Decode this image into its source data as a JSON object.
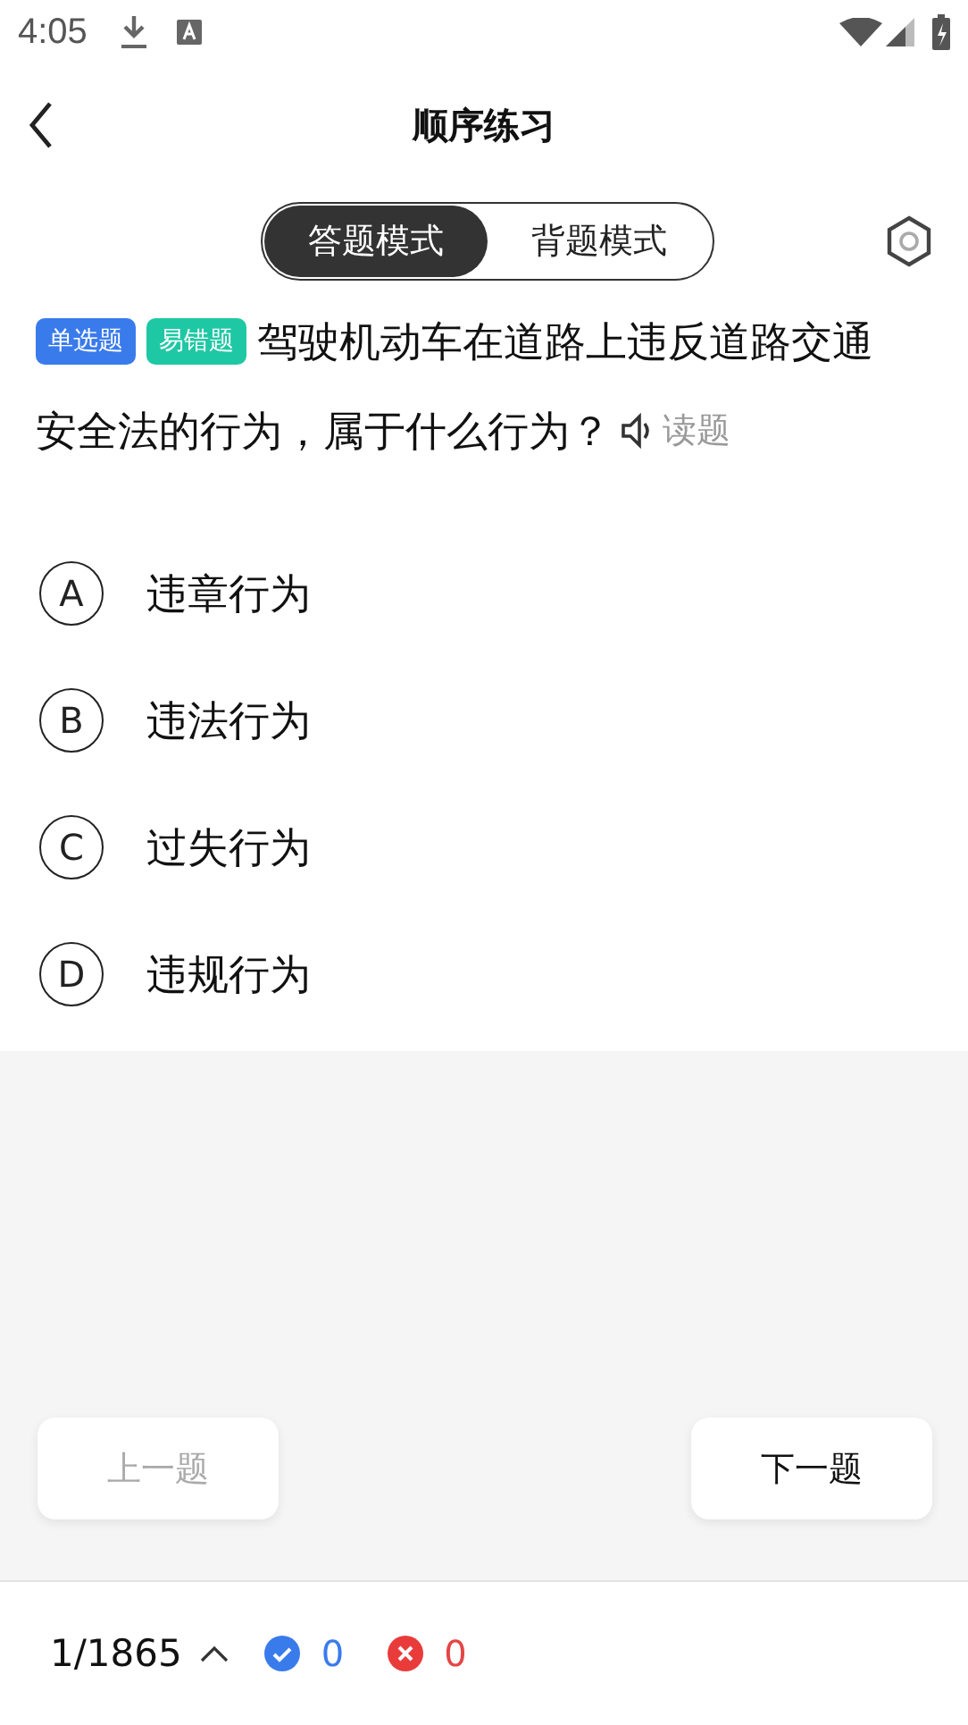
{
  "status_bar": {
    "time": "4:05"
  },
  "header": {
    "title": "顺序练习"
  },
  "mode_tabs": [
    {
      "label": "答题模式",
      "selected": true
    },
    {
      "label": "背题模式",
      "selected": false
    }
  ],
  "question": {
    "tags": [
      {
        "label": "单选题",
        "color": "#3a7bec"
      },
      {
        "label": "易错题",
        "color": "#1fc8a4"
      }
    ],
    "text_lines": [
      "驾驶机动车在道路上违反道路交通",
      "安全法的行为，属于什么行为？"
    ],
    "read_label": "读题"
  },
  "options": [
    {
      "letter": "A",
      "text": "违章行为",
      "selected": false
    },
    {
      "letter": "B",
      "text": "违法行为",
      "selected": false
    },
    {
      "letter": "C",
      "text": "过失行为",
      "selected": false
    },
    {
      "letter": "D",
      "text": "违规行为",
      "selected": false
    }
  ],
  "nav": {
    "prev": {
      "label": "上一题",
      "disabled": true
    },
    "next": {
      "label": "下一题",
      "disabled": false
    }
  },
  "footer": {
    "progress": "1/1865",
    "correct": "0",
    "wrong": "0"
  }
}
